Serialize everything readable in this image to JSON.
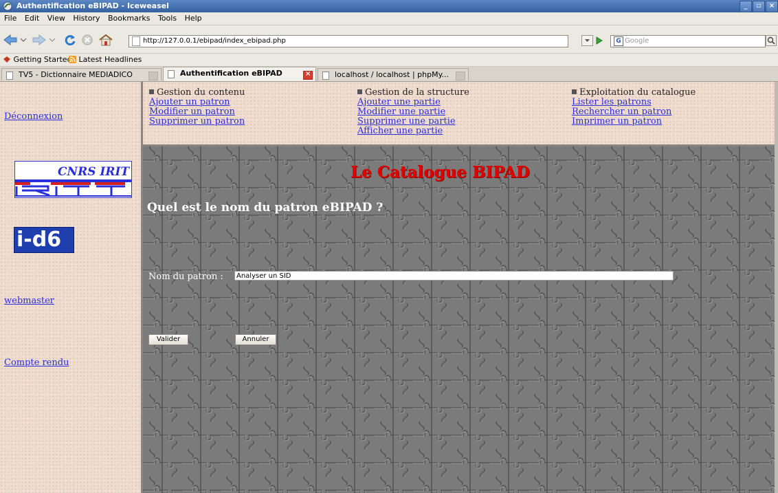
{
  "window": {
    "title": "Authentification eBIPAD - Iceweasel",
    "controls": [
      "_",
      "▫",
      "×"
    ]
  },
  "menu": [
    "File",
    "Edit",
    "View",
    "History",
    "Bookmarks",
    "Tools",
    "Help"
  ],
  "toolbar": {
    "url": "http://127.0.0.1/ebipad/index_ebipad.php",
    "search_engine": "G",
    "search_placeholder": "Google"
  },
  "bookmarks": [
    "Getting Started",
    "Latest Headlines"
  ],
  "tabs": [
    {
      "label": "TV5 - Dictionnaire MEDIADICO",
      "active": false
    },
    {
      "label": "Authentification eBIPAD",
      "active": true
    },
    {
      "label": "localhost / localhost | phpMy...",
      "active": false
    }
  ],
  "sidebar": {
    "deconnexion": "Déconnexion",
    "cnrs_logo": "CNRS IRIT",
    "id6_logo": "i-d6",
    "webmaster": "webmaster",
    "compte_rendu": "Compte rendu"
  },
  "nav": {
    "contenu": {
      "heading": "Gestion du contenu",
      "links": [
        "Ajouter un patron",
        "Modifier un patron",
        "Supprimer un patron"
      ]
    },
    "structure": {
      "heading": "Gestion de la structure",
      "links": [
        "Ajouter une partie",
        "Modifier une partie",
        "Supprimer une partie",
        "Afficher une partie"
      ]
    },
    "exploitation": {
      "heading": "Exploitation du catalogue",
      "links": [
        "Lister les patrons",
        "Rechercher un patron",
        "Imprimer un patron"
      ]
    }
  },
  "main": {
    "title": "Le Catalogue BIPAD",
    "question": "Quel est le nom du patron eBIPAD ?",
    "field_label": "Nom du patron :",
    "field_value": "Analyser un SID",
    "submit": "Valider",
    "cancel": "Annuler"
  },
  "colors": {
    "link": "#2a2fd8",
    "title_red": "#e00000",
    "sidebar_bg": "#efdccf",
    "main_bg": "#7a7a7a"
  }
}
